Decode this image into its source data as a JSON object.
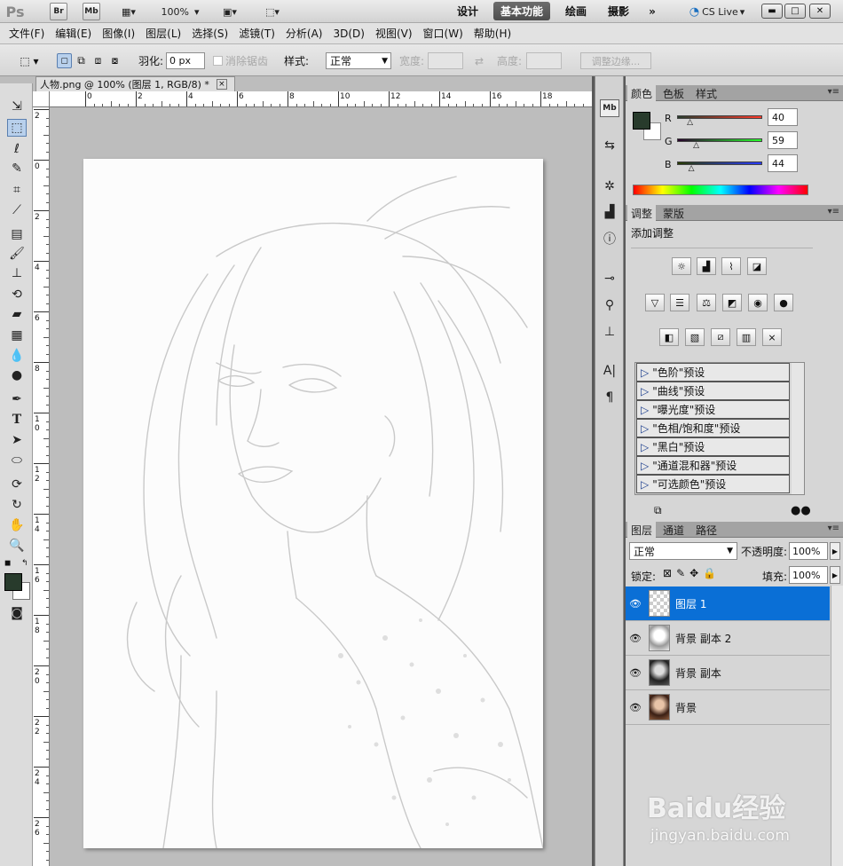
{
  "app": {
    "logo": "Ps",
    "bridge": "Br",
    "minibridge": "Mb",
    "zoom": "100%",
    "cslive": "CS Live"
  },
  "workspaces": [
    "设计",
    "基本功能",
    "绘画",
    "摄影"
  ],
  "menu": [
    "文件(F)",
    "编辑(E)",
    "图像(I)",
    "图层(L)",
    "选择(S)",
    "滤镜(T)",
    "分析(A)",
    "3D(D)",
    "视图(V)",
    "窗口(W)",
    "帮助(H)"
  ],
  "options": {
    "feather_label": "羽化:",
    "feather_value": "0 px",
    "antialias_label": "消除锯齿",
    "style_label": "样式:",
    "style_value": "正常",
    "width_label": "宽度:",
    "height_label": "高度:",
    "refine_button": "调整边缘..."
  },
  "document": {
    "tab_title": "人物.png @ 100% (图层 1, RGB/8) *",
    "close": "×"
  },
  "rulers": {
    "horizontal": [
      "0",
      "2",
      "4",
      "6",
      "8",
      "10",
      "12",
      "14",
      "16",
      "18"
    ],
    "vertical": [
      "2",
      "0",
      "2",
      "4",
      "6",
      "8",
      "10",
      "12",
      "14",
      "16",
      "18",
      "20",
      "22",
      "24",
      "26"
    ]
  },
  "color_panel": {
    "tabs": [
      "颜色",
      "色板",
      "样式"
    ],
    "channels": [
      {
        "label": "R",
        "value": "40",
        "fraction": 0.157
      },
      {
        "label": "G",
        "value": "59",
        "fraction": 0.231
      },
      {
        "label": "B",
        "value": "44",
        "fraction": 0.173
      }
    ],
    "foreground": "#283b2c",
    "background": "#ffffff"
  },
  "adjust_panel": {
    "tabs": [
      "调整",
      "蒙版"
    ],
    "title": "添加调整",
    "presets": [
      "\"色阶\"预设",
      "\"曲线\"预设",
      "\"曝光度\"预设",
      "\"色相/饱和度\"预设",
      "\"黑白\"预设",
      "\"通道混和器\"预设",
      "\"可选颜色\"预设"
    ]
  },
  "layers_panel": {
    "tabs": [
      "图层",
      "通道",
      "路径"
    ],
    "blend_mode": "正常",
    "opacity_label": "不透明度:",
    "opacity_value": "100%",
    "lock_label": "锁定:",
    "fill_label": "填充:",
    "fill_value": "100%",
    "layers": [
      {
        "name": "图层 1",
        "selected": true
      },
      {
        "name": "背景 副本 2",
        "selected": false
      },
      {
        "name": "背景 副本",
        "selected": false
      },
      {
        "name": "背景",
        "selected": false
      }
    ]
  },
  "watermark": {
    "brand": "Baidu经验",
    "url": "jingyan.baidu.com"
  }
}
